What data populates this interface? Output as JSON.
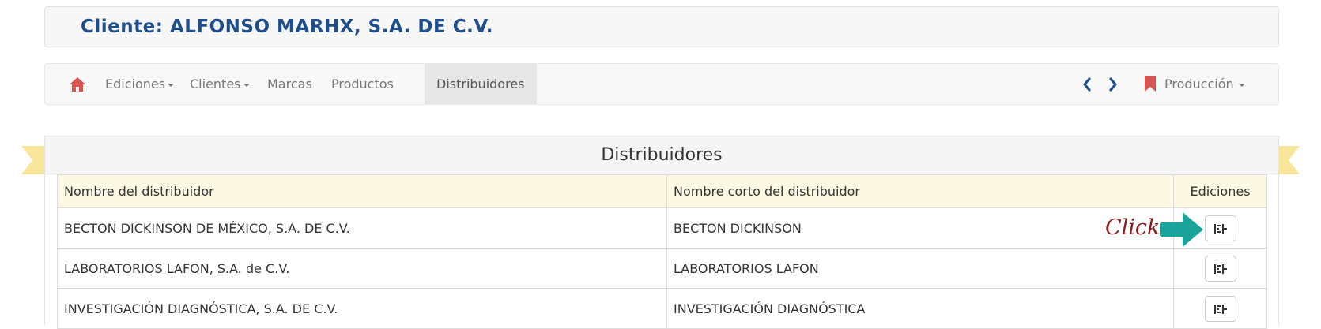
{
  "client": {
    "label": "Cliente:",
    "name": "ALFONSO MARHX, S.A. DE C.V."
  },
  "nav": {
    "items": [
      {
        "label": "Ediciones",
        "caret": true
      },
      {
        "label": "Clientes",
        "caret": true
      },
      {
        "label": "Marcas",
        "caret": false
      },
      {
        "label": "Productos",
        "caret": false
      },
      {
        "label": "Distribuidores",
        "caret": false,
        "active": true
      }
    ],
    "production": {
      "label": "Producción",
      "caret": true
    },
    "icons": [
      "home-icon",
      "chevron-left-icon",
      "chevron-right-icon",
      "bookmark-icon"
    ]
  },
  "panel": {
    "title": "Distribuidores",
    "columns": [
      "Nombre del distribuidor",
      "Nombre corto del distribuidor",
      "Ediciones"
    ],
    "rows": [
      {
        "name": "BECTON DICKINSON DE MÉXICO, S.A. DE C.V.",
        "short": "BECTON DICKINSON"
      },
      {
        "name": "LABORATORIOS LAFON, S.A. de C.V.",
        "short": "LABORATORIOS LAFON"
      },
      {
        "name": "INVESTIGACIÓN DIAGNÓSTICA, S.A. DE C.V.",
        "short": "INVESTIGACIÓN DIAGNÓSTICA"
      }
    ]
  },
  "annotation": {
    "label": "Click"
  },
  "colors": {
    "client_title": "#1f4e8c",
    "home_icon": "#d9534f",
    "bookmark_icon": "#d9534f",
    "chevrons": "#1f4e8c",
    "table_header_bg": "#fcf8e3",
    "ribbon": "#f8e79a",
    "annotation_text": "#8b1a1a",
    "annotation_arrow": "#1aa39a"
  }
}
